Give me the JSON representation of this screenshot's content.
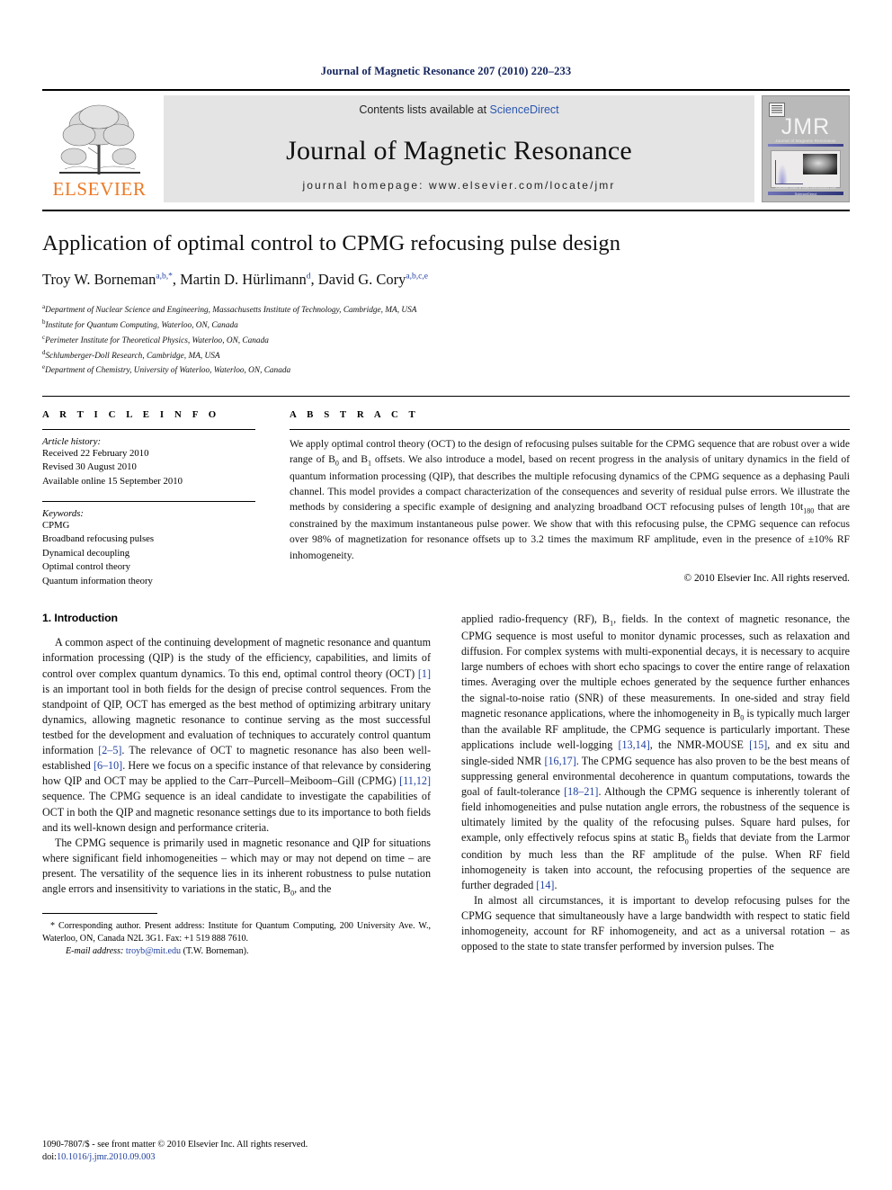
{
  "running_head": "Journal of Magnetic Resonance 207 (2010) 220–233",
  "masthead": {
    "contents_prefix": "Contents lists available at ",
    "sciencedirect": "ScienceDirect",
    "journal_name": "Journal of Magnetic Resonance",
    "homepage": "journal homepage: www.elsevier.com/locate/jmr",
    "publisher_wordmark": "ELSEVIER",
    "cover": {
      "title": "JMR",
      "subtitle": "Journal of Magnetic Resonance",
      "footer_line1": "Available online at www.sciencedirect.com",
      "footer_line2": "ScienceDirect"
    },
    "link_color": "#2b56b0",
    "publisher_color": "#ec7a26"
  },
  "article": {
    "title": "Application of optimal control to CPMG refocusing pulse design",
    "authors": [
      {
        "name": "Troy W. Borneman",
        "marks": "a,b,*"
      },
      {
        "name": "Martin D. Hürlimann",
        "marks": "d"
      },
      {
        "name": "David G. Cory",
        "marks": "a,b,c,e"
      }
    ],
    "affiliations": [
      {
        "mark": "a",
        "text": "Department of Nuclear Science and Engineering, Massachusetts Institute of Technology, Cambridge, MA, USA"
      },
      {
        "mark": "b",
        "text": "Institute for Quantum Computing, Waterloo, ON, Canada"
      },
      {
        "mark": "c",
        "text": "Perimeter Institute for Theoretical Physics, Waterloo, ON, Canada"
      },
      {
        "mark": "d",
        "text": "Schlumberger-Doll Research, Cambridge, MA, USA"
      },
      {
        "mark": "e",
        "text": "Department of Chemistry, University of Waterloo, Waterloo, ON, Canada"
      }
    ]
  },
  "article_info": {
    "heading": "A R T I C L E    I N F O",
    "history_label": "Article history:",
    "history": [
      "Received 22 February 2010",
      "Revised 30 August 2010",
      "Available online 15 September 2010"
    ],
    "keywords_label": "Keywords:",
    "keywords": [
      "CPMG",
      "Broadband refocusing pulses",
      "Dynamical decoupling",
      "Optimal control theory",
      "Quantum information theory"
    ]
  },
  "abstract": {
    "heading": "A B S T R A C T",
    "part1": "We apply optimal control theory (OCT) to the design of refocusing pulses suitable for the CPMG sequence that are robust over a wide range of B",
    "sub_0a": "0",
    "part2": " and B",
    "sub_1a": "1",
    "part3": " offsets. We also introduce a model, based on recent progress in the analysis of unitary dynamics in the field of quantum information processing (QIP), that describes the multiple refocusing dynamics of the CPMG sequence as a dephasing Pauli channel. This model provides a compact characterization of the consequences and severity of residual pulse errors. We illustrate the methods by considering a specific example of designing and analyzing broadband OCT refocusing pulses of length 10t",
    "sub_180": "180",
    "part4": " that are constrained by the maximum instantaneous pulse power. We show that with this refocusing pulse, the CPMG sequence can refocus over 98% of magnetization for resonance offsets up to 3.2 times the maximum RF amplitude, even in the presence of ±10% RF inhomogeneity.",
    "copyright": "© 2010 Elsevier Inc. All rights reserved."
  },
  "body": {
    "section_heading": "1. Introduction",
    "left": {
      "p1_a": "A common aspect of the continuing development of magnetic resonance and quantum information processing (QIP) is the study of the efficiency, capabilities, and limits of control over complex quantum dynamics. To this end, optimal control theory (OCT) ",
      "c1": "[1]",
      "p1_b": " is an important tool in both fields for the design of precise control sequences. From the standpoint of QIP, OCT has emerged as the best method of optimizing arbitrary unitary dynamics, allowing magnetic resonance to continue serving as the most successful testbed for the development and evaluation of techniques to accurately control quantum information ",
      "c2": "[2–5]",
      "p1_c": ". The relevance of OCT to magnetic resonance has also been well-established ",
      "c3": "[6–10]",
      "p1_d": ". Here we focus on a specific instance of that relevance by considering how QIP and OCT may be applied to the Carr–Purcell–Meiboom–Gill (CPMG) ",
      "c4": "[11,12]",
      "p1_e": " sequence. The CPMG sequence is an ideal candidate to investigate the capabilities of OCT in both the QIP and magnetic resonance settings due to its importance to both fields and its well-known design and performance criteria.",
      "p2_a": "The CPMG sequence is primarily used in magnetic resonance and QIP for situations where significant field inhomogeneities – which may or may not depend on time – are present. The versatility of the sequence lies in its inherent robustness to pulse nutation angle errors and insensitivity to variations in the static, B",
      "sub_0": "0",
      "p2_b": ", and the"
    },
    "right": {
      "p1_a": "applied radio-frequency (RF), B",
      "sub_1": "1",
      "p1_b": ", fields. In the context of magnetic resonance, the CPMG sequence is most useful to monitor dynamic processes, such as relaxation and diffusion. For complex systems with multi-exponential decays, it is necessary to acquire large numbers of echoes with short echo spacings to cover the entire range of relaxation times. Averaging over the multiple echoes generated by the sequence further enhances the signal-to-noise ratio (SNR) of these measurements. In one-sided and stray field magnetic resonance applications, where the inhomogeneity in B",
      "sub_0": "0",
      "p1_c": " is typically much larger than the available RF amplitude, the CPMG sequence is particularly important. These applications include well-logging ",
      "c5": "[13,14]",
      "p1_d": ", the NMR-MOUSE ",
      "c6": "[15]",
      "p1_e": ", and ex situ and single-sided NMR ",
      "c7": "[16,17]",
      "p1_f": ". The CPMG sequence has also proven to be the best means of suppressing general environmental decoherence in quantum computations, towards the goal of fault-tolerance ",
      "c8": "[18–21]",
      "p1_g": ". Although the CPMG sequence is inherently tolerant of field inhomogeneities and pulse nutation angle errors, the robustness of the sequence is ultimately limited by the quality of the refocusing pulses. Square hard pulses, for example, only effectively refocus spins at static B",
      "sub_0b": "0",
      "p1_h": " fields that deviate from the Larmor condition by much less than the RF amplitude of the pulse. When RF field inhomogeneity is taken into account, the refocusing properties of the sequence are further degraded ",
      "c9": "[14]",
      "p1_i": ".",
      "p2": "In almost all circumstances, it is important to develop refocusing pulses for the CPMG sequence that simultaneously have a large bandwidth with respect to static field inhomogeneity, account for RF inhomogeneity, and act as a universal rotation – as opposed to the state to state transfer performed by inversion pulses. The"
    }
  },
  "footnote": {
    "star_a": "* Corresponding author. Present address: Institute for Quantum Computing, 200 University Ave. W., Waterloo, ON, Canada N2L 3G1. Fax: +1 519 888 7610.",
    "email_label": "E-mail address:",
    "email": "troyb@mit.edu",
    "email_owner": "(T.W. Borneman)."
  },
  "page_footer": {
    "line1": "1090-7807/$ - see front matter © 2010 Elsevier Inc. All rights reserved.",
    "doi_label": "doi:",
    "doi": "10.1016/j.jmr.2010.09.003"
  }
}
